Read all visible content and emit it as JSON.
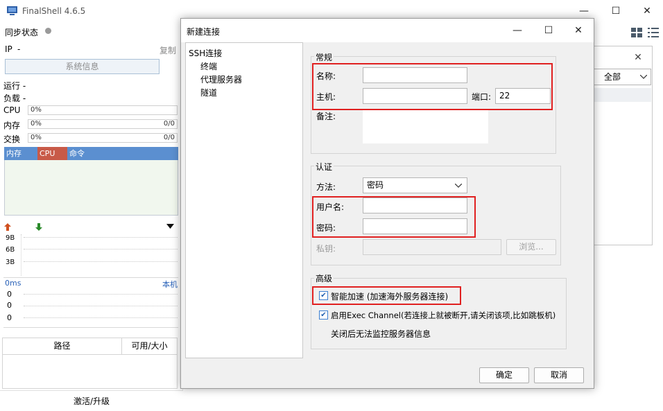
{
  "app": {
    "title": "FinalShell 4.6.5",
    "window_controls": [
      "minimize-icon",
      "maximize-icon",
      "close-icon"
    ]
  },
  "left": {
    "sync_label": "同步状态",
    "ip_label": "IP",
    "ip_value": "-",
    "copy_label": "复制",
    "sysinfo_button": "系统信息",
    "run_label": "运行 -",
    "load_label": "负载 -",
    "cpu_label": "CPU",
    "cpu_value": "0%",
    "mem_label": "内存",
    "mem_value": "0%",
    "mem_ratio": "0/0",
    "swap_label": "交换",
    "swap_value": "0%",
    "swap_ratio": "0/0",
    "proc_cols": [
      "内存",
      "CPU",
      "命令"
    ],
    "net_scale": [
      "9B",
      "6B",
      "3B"
    ],
    "latency": "0ms",
    "latency_host": "本机",
    "latency_values": [
      "0",
      "0",
      "0"
    ],
    "table_cols": [
      "路径",
      "可用/大小"
    ],
    "activate": "激活/升级"
  },
  "bg_window": {
    "filter_value": "全部"
  },
  "dialog": {
    "title": "新建连接",
    "tree": [
      "SSH连接",
      "终端",
      "代理服务器",
      "隧道"
    ],
    "general": {
      "title": "常规",
      "name_label": "名称:",
      "name_value": "",
      "host_label": "主机:",
      "host_value": "",
      "port_label": "端口:",
      "port_value": "22",
      "note_label": "备注:",
      "note_value": ""
    },
    "auth": {
      "title": "认证",
      "method_label": "方法:",
      "method_value": "密码",
      "user_label": "用户名:",
      "user_value": "",
      "pass_label": "密码:",
      "pass_value": "",
      "key_label": "私钥:",
      "browse_button": "浏览..."
    },
    "advanced": {
      "title": "高级",
      "smart_accel": "智能加速 (加速海外服务器连接)",
      "smart_accel_checked": true,
      "exec_channel": "启用Exec Channel(若连接上就被断开,请关闭该项,比如跳板机)",
      "exec_channel_checked": true,
      "exec_note": "关闭后无法监控服务器信息"
    },
    "ok_button": "确定",
    "cancel_button": "取消"
  },
  "colors": {
    "highlight_box": "#e02020",
    "proc_header": "#5b8fd0",
    "cpu_header": "#c85a48",
    "up_arrow": "#d05020",
    "down_arrow": "#2a8a2a"
  }
}
